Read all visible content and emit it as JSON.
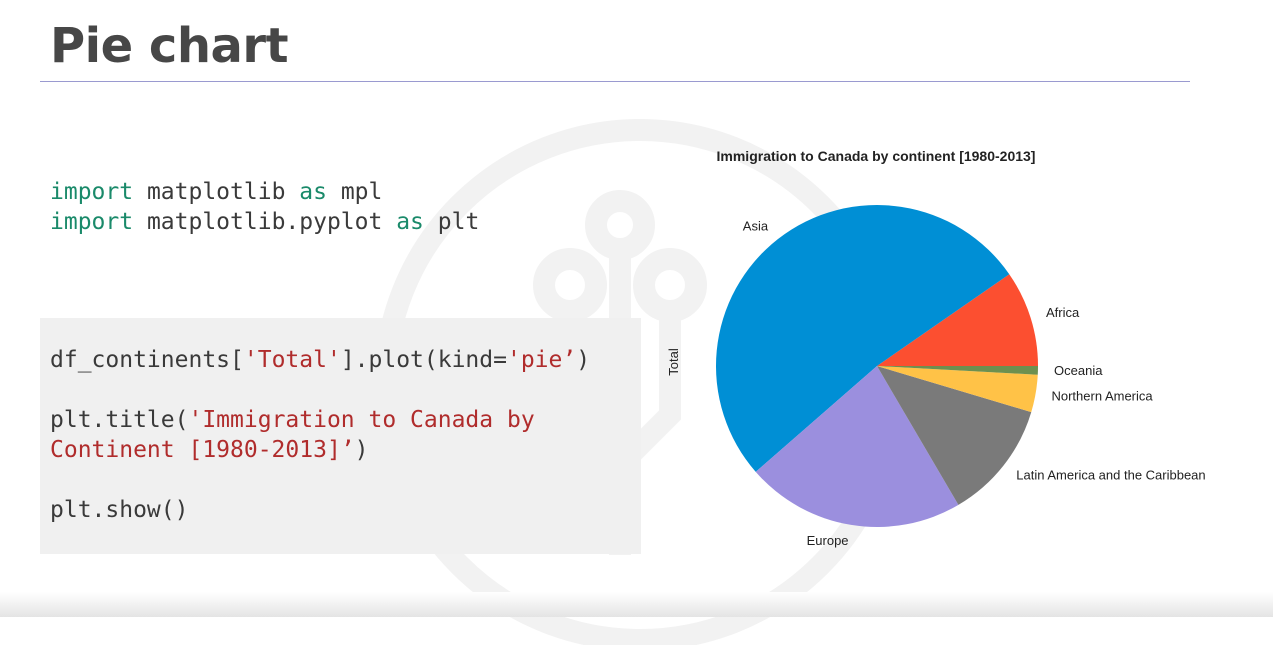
{
  "slide": {
    "title": "Pie chart"
  },
  "code": {
    "import_block": [
      {
        "line": 1,
        "parts": [
          {
            "kind": "kw",
            "text": "import"
          },
          {
            "kind": "plain",
            "text": " matplotlib "
          },
          {
            "kind": "kw",
            "text": "as"
          },
          {
            "kind": "plain",
            "text": " mpl"
          }
        ]
      },
      {
        "line": 2,
        "parts": [
          {
            "kind": "kw",
            "text": "import"
          },
          {
            "kind": "plain",
            "text": " matplotlib.pyplot "
          },
          {
            "kind": "kw",
            "text": "as"
          },
          {
            "kind": "plain",
            "text": " plt"
          }
        ]
      }
    ],
    "plot_block": [
      {
        "line": 1,
        "parts": [
          {
            "kind": "plain",
            "text": "df_continents["
          },
          {
            "kind": "str",
            "text": "'Total'"
          },
          {
            "kind": "plain",
            "text": "].plot(kind="
          },
          {
            "kind": "str",
            "text": "'pie’"
          },
          {
            "kind": "plain",
            "text": ")"
          }
        ]
      },
      {
        "line": 2,
        "parts": [
          {
            "kind": "plain",
            "text": "plt.title("
          },
          {
            "kind": "str",
            "text": "'Immigration to Canada by"
          }
        ]
      },
      {
        "line": 3,
        "parts": [
          {
            "kind": "str",
            "text": "Continent [1980-2013]’"
          },
          {
            "kind": "plain",
            "text": ")"
          }
        ]
      },
      {
        "line": 4,
        "parts": [
          {
            "kind": "plain",
            "text": "plt.show()"
          }
        ]
      }
    ]
  },
  "chart_data": {
    "type": "pie",
    "title": "Immigration to Canada by continent [1980-2013]",
    "ylabel": "Total",
    "start_angle_deg": 0,
    "direction": "counterclockwise",
    "categories": [
      "Africa",
      "Asia",
      "Europe",
      "Latin America and the Caribbean",
      "Northern America",
      "Oceania"
    ],
    "values": [
      618948,
      3317794,
      1410947,
      765148,
      241142,
      55174
    ],
    "colors": [
      "#fc4f30",
      "#008fd5",
      "#9b8fde",
      "#7a7a7a",
      "#ffc247",
      "#6d904f"
    ]
  },
  "icons": {
    "background_watermark": "circuit-logo-icon"
  }
}
